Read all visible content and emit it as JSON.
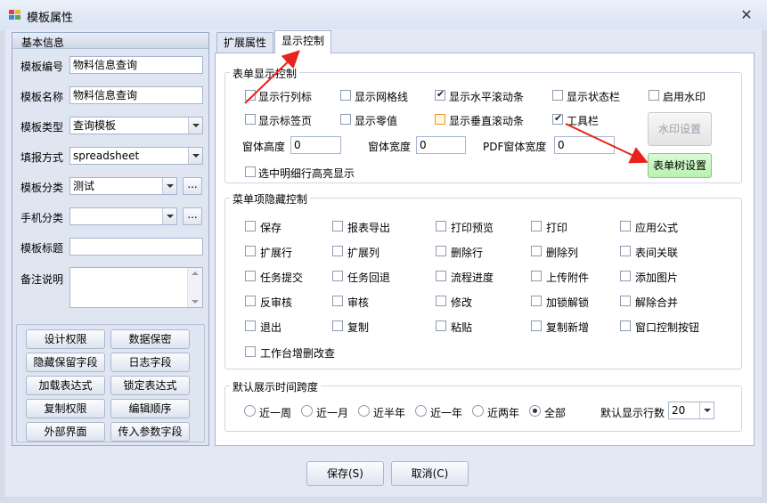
{
  "window": {
    "title": "模板属性"
  },
  "left": {
    "section_title": "基本信息",
    "fields": {
      "template_code_label": "模板编号",
      "template_code_value": "物料信息查询",
      "template_name_label": "模板名称",
      "template_name_value": "物料信息查询",
      "template_type_label": "模板类型",
      "template_type_value": "查询模板",
      "report_mode_label": "填报方式",
      "report_mode_value": "spreadsheet",
      "template_category_label": "模板分类",
      "template_category_value": "测试",
      "mobile_category_label": "手机分类",
      "mobile_category_value": "",
      "template_title_label": "模板标题",
      "template_title_value": "",
      "remark_label": "备注说明",
      "remark_value": "",
      "ellipsis": "..."
    },
    "buttons": [
      "设计权限",
      "数据保密",
      "隐藏保留字段",
      "日志字段",
      "加载表达式",
      "锁定表达式",
      "复制权限",
      "编辑顺序",
      "外部界面",
      "传入参数字段"
    ]
  },
  "tabs": [
    "扩展属性",
    "显示控制"
  ],
  "form_display": {
    "title": "表单显示控制",
    "checkboxes": [
      {
        "label": "显示行列标",
        "checked": false
      },
      {
        "label": "显示网格线",
        "checked": false
      },
      {
        "label": "显示水平滚动条",
        "checked": true
      },
      {
        "label": "显示状态栏",
        "checked": false
      },
      {
        "label": "启用水印",
        "checked": false
      },
      {
        "label": "显示标签页",
        "checked": false
      },
      {
        "label": "显示零值",
        "checked": false
      },
      {
        "label": "显示垂直滚动条",
        "checked": false
      },
      {
        "label": "工具栏",
        "checked": true
      }
    ],
    "highlight_label": "选中明细行高亮显示",
    "height_label": "窗体高度",
    "height_value": "0",
    "width_label": "窗体宽度",
    "width_value": "0",
    "pdf_width_label": "PDF窗体宽度",
    "pdf_width_value": "0",
    "watermark_button": "水印设置",
    "form_tree_button": "表单树设置"
  },
  "menu_hide": {
    "title": "菜单项隐藏控制",
    "items": [
      "保存",
      "报表导出",
      "打印预览",
      "打印",
      "应用公式",
      "扩展行",
      "扩展列",
      "删除行",
      "删除列",
      "表间关联",
      "任务提交",
      "任务回退",
      "流程进度",
      "上传附件",
      "添加图片",
      "反审核",
      "审核",
      "修改",
      "加锁解锁",
      "解除合并",
      "退出",
      "复制",
      "粘贴",
      "复制新增",
      "窗口控制按钮",
      "工作台增删改查"
    ]
  },
  "time_span": {
    "title": "默认展示时间跨度",
    "options": [
      "近一周",
      "近一月",
      "近半年",
      "近一年",
      "近两年",
      "全部"
    ],
    "selected": "全部",
    "rows_label": "默认显示行数",
    "rows_value": "20"
  },
  "footer": {
    "save": "保存(S)",
    "cancel": "取消(C)"
  }
}
